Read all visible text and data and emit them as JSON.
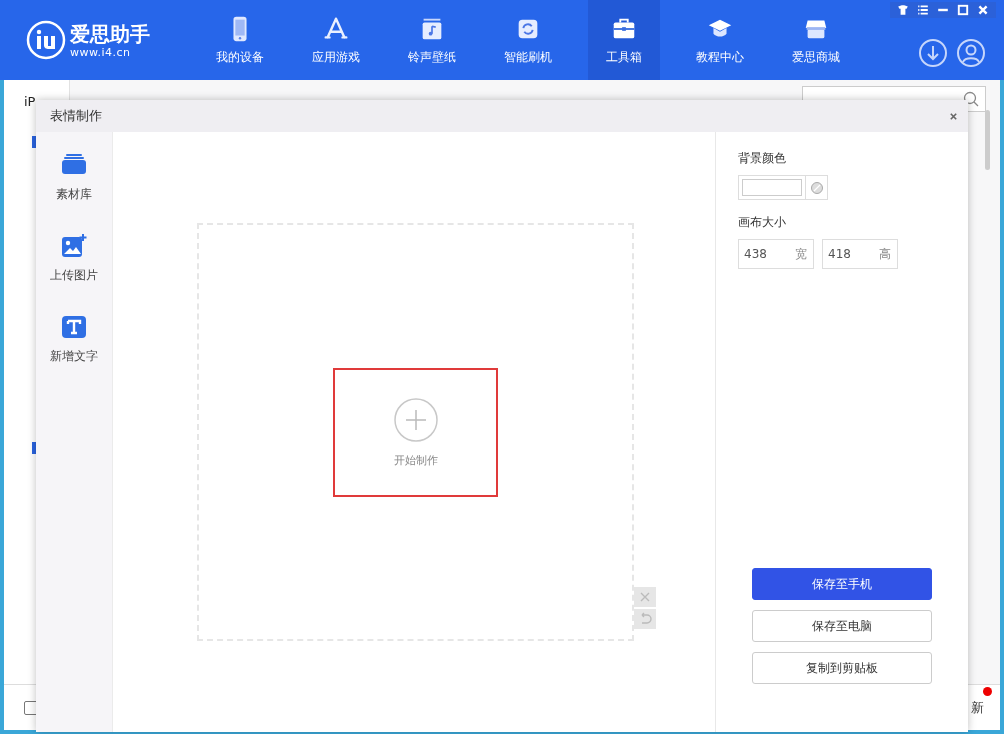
{
  "app": {
    "logo_title": "爱思助手",
    "logo_url": "www.i4.cn"
  },
  "nav": [
    {
      "label": "我的设备",
      "kind": "phone",
      "selected": false
    },
    {
      "label": "应用游戏",
      "kind": "apps",
      "selected": false
    },
    {
      "label": "铃声壁纸",
      "kind": "music",
      "selected": false
    },
    {
      "label": "智能刷机",
      "kind": "refresh",
      "selected": false
    },
    {
      "label": "工具箱",
      "kind": "toolbox",
      "selected": true
    },
    {
      "label": "教程中心",
      "kind": "cap",
      "selected": false
    },
    {
      "label": "爱思商城",
      "kind": "store",
      "selected": false
    }
  ],
  "background": {
    "sidebar_text": "iP",
    "checkbox": {
      "checked": false
    },
    "footer_text": "新",
    "has_badge": true
  },
  "dialog": {
    "title": "表情制作",
    "tools": [
      {
        "label": "素材库",
        "kind": "library"
      },
      {
        "label": "上传图片",
        "kind": "image"
      },
      {
        "label": "新增文字",
        "kind": "text"
      }
    ],
    "canvas": {
      "prompt": "开始制作",
      "highlighted": true
    },
    "settings": {
      "background_label": "背景颜色",
      "size_label": "画布大小",
      "width": {
        "value": "438",
        "unit": "宽"
      },
      "height": {
        "value": "418",
        "unit": "高"
      }
    },
    "buttons": [
      {
        "label": "保存至手机",
        "primary": true
      },
      {
        "label": "保存至电脑",
        "primary": false
      },
      {
        "label": "复制到剪贴板",
        "primary": false
      }
    ]
  }
}
